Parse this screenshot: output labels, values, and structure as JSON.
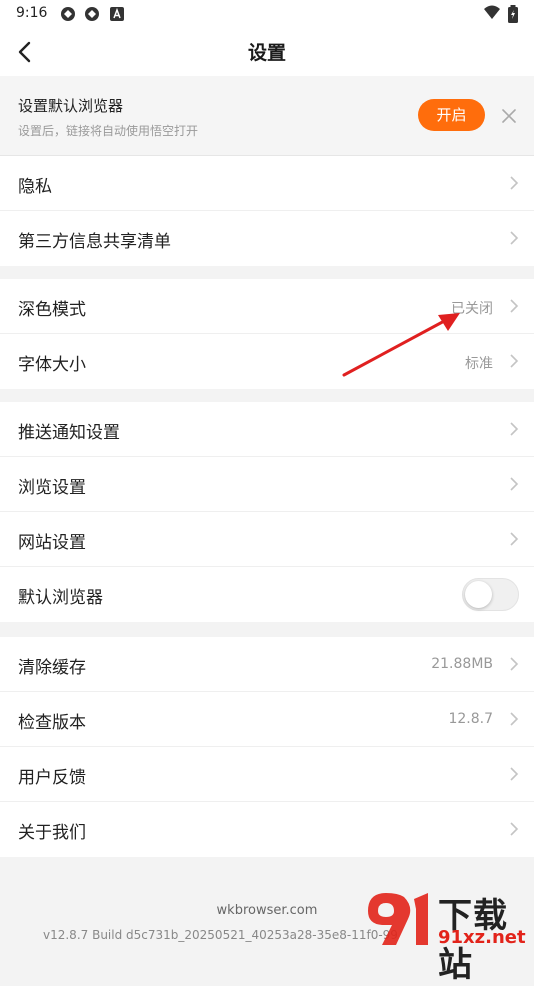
{
  "status_bar": {
    "time": "9:16",
    "icons": [
      "app-icon",
      "app-icon",
      "a-icon"
    ],
    "right_icons": [
      "wifi-icon",
      "battery-icon"
    ]
  },
  "header": {
    "title": "设置",
    "back_icon": "back-arrow-icon"
  },
  "banner": {
    "title": "设置默认浏览器",
    "subtitle": "设置后，链接将自动使用悟空打开",
    "button_label": "开启",
    "button_color": "#ff6d0c"
  },
  "groups": [
    {
      "rows": [
        {
          "label": "隐私",
          "value": ""
        },
        {
          "label": "第三方信息共享清单",
          "value": ""
        }
      ]
    },
    {
      "rows": [
        {
          "label": "深色模式",
          "value": "已关闭"
        },
        {
          "label": "字体大小",
          "value": "标准"
        }
      ]
    },
    {
      "rows": [
        {
          "label": "推送通知设置",
          "value": ""
        },
        {
          "label": "浏览设置",
          "value": ""
        },
        {
          "label": "网站设置",
          "value": ""
        },
        {
          "label": "默认浏览器",
          "toggle": false
        }
      ]
    },
    {
      "rows": [
        {
          "label": "清除缓存",
          "value": "21.88MB"
        },
        {
          "label": "检查版本",
          "value": "12.8.7"
        },
        {
          "label": "用户反馈",
          "value": ""
        },
        {
          "label": "关于我们",
          "value": ""
        }
      ]
    }
  ],
  "footer": {
    "host": "wkbrowser.com",
    "build": "v12.8.7 Build d5c731b_20250521_40253a28-35e8-11f0-99"
  },
  "watermark": {
    "top": "下载站",
    "bottom": "91xz.net"
  },
  "annotation_color": "#e02020"
}
